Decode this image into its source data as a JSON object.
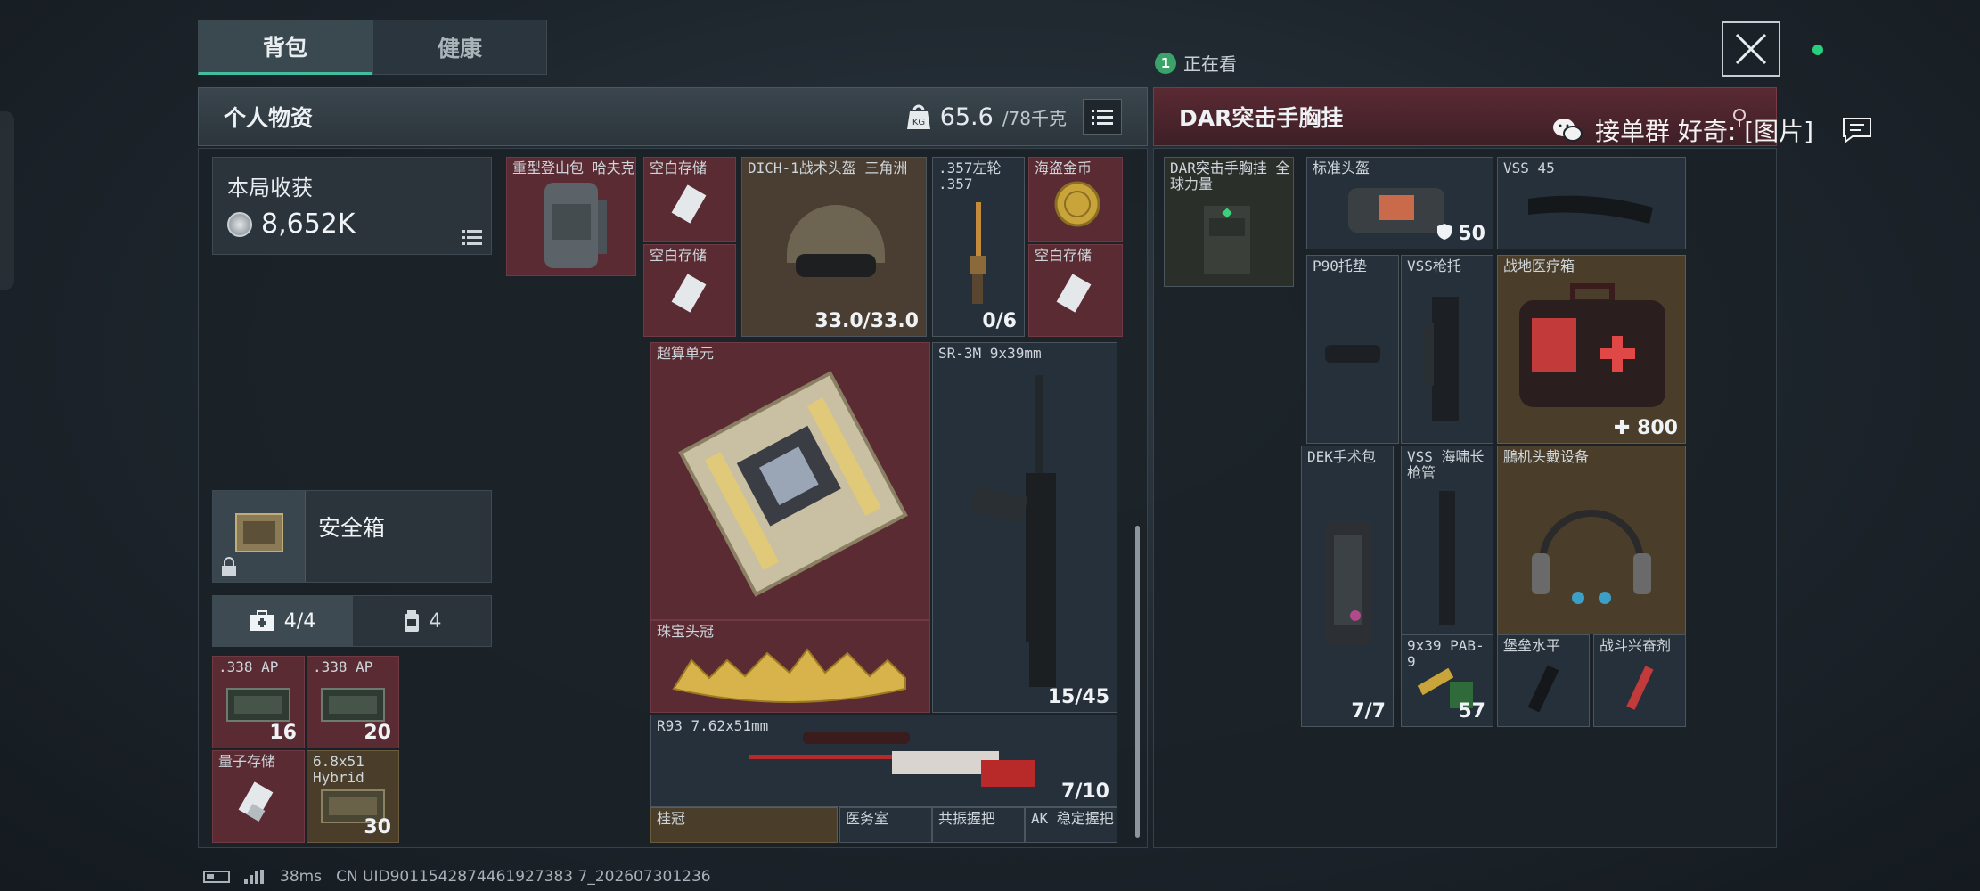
{
  "tabs": [
    {
      "label": "背包",
      "active": true
    },
    {
      "label": "健康",
      "active": false
    }
  ],
  "watching": {
    "count": "1",
    "label": "正在看"
  },
  "personal": {
    "title": "个人物资",
    "weight": "65.6",
    "weight_max": "/78千克"
  },
  "rig": {
    "title": "DAR突击手胸挂"
  },
  "wechat": {
    "text": "接单群  好奇: [图片]"
  },
  "harvest": {
    "label": "本局收获",
    "value": "8,652K"
  },
  "safebox": {
    "label": "安全箱"
  },
  "sub_tabs": [
    {
      "label": "4/4",
      "icon": "medkit-icon",
      "active": true
    },
    {
      "label": "4",
      "icon": "canister-icon",
      "active": false
    }
  ],
  "safe_items": [
    {
      "name": ".338 AP",
      "count": "16"
    },
    {
      "name": ".338 AP",
      "count": "20"
    },
    {
      "name": "量子存储",
      "count": ""
    },
    {
      "name": "6.8x51 Hybrid",
      "count": "30"
    }
  ],
  "backpack_items": {
    "bag": {
      "name": "重型登山包 哈夫克"
    },
    "storage1": {
      "name": "空白存储"
    },
    "storage2": {
      "name": "空白存储"
    },
    "helmet": {
      "name": "DICH-1战术头盔 三角洲",
      "count": "33.0/33.0"
    },
    "revolver_ammo": {
      "name": ".357左轮 .357",
      "count": "0/6"
    },
    "coin": {
      "name": "海盗金币"
    },
    "storage3": {
      "name": "空白存储"
    },
    "supercomputer": {
      "name": "超算单元"
    },
    "sr3m": {
      "name": "SR-3M 9x39mm",
      "count": "15/45"
    },
    "crown": {
      "name": "珠宝头冠"
    },
    "r93": {
      "name": "R93 7.62x51mm",
      "count": "7/10"
    },
    "bottom1": {
      "name": "桂冠"
    },
    "bottom2": {
      "name": "医务室"
    },
    "bottom3": {
      "name": "共振握把"
    },
    "bottom4": {
      "name": "AK 稳定握把"
    }
  },
  "rig_items": {
    "rig": {
      "name": "DAR突击手胸挂 全球力量"
    },
    "bag": {
      "name": "标准头盔",
      "count": "50"
    },
    "mag": {
      "name": "VSS 45"
    },
    "p90": {
      "name": "P90托垫"
    },
    "vss_stock": {
      "name": "VSS枪托"
    },
    "medkit": {
      "name": "战地医疗箱",
      "count": "800"
    },
    "dek": {
      "name": "DEK手术包",
      "count": "7/7"
    },
    "vss_barrel": {
      "name": "VSS 海啸长枪管"
    },
    "ammo": {
      "name": "9x39 PAB-9",
      "count": "57"
    },
    "headset": {
      "name": "鵬机头戴设备"
    },
    "fortress": {
      "name": "堡垒水平"
    },
    "stim": {
      "name": "战斗兴奋剂"
    }
  },
  "status": {
    "ping": "38ms",
    "uid": "CN UID9011542874461927383 7_202607301236"
  },
  "colors": {
    "accent": "#3fbfa0",
    "red_cell": "#5a2b33",
    "dot": "#26d07c"
  }
}
